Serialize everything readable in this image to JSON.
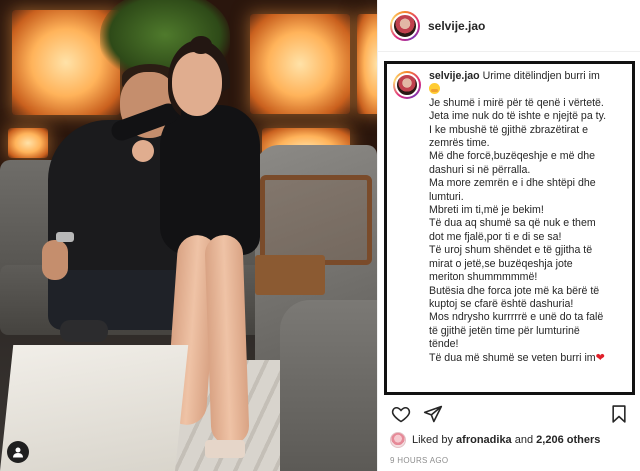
{
  "post": {
    "username": "selvije.jao",
    "caption_lines": [
      "Urime ditëlindjen burri im",
      "Je shumë i mirë për të qenë i vërtetë.",
      "Jeta ime nuk do të ishte e njejtë pa ty.",
      "I ke mbushë të gjithë zbrazëtirat e",
      "zemrës time.",
      "Më dhe forcë,buzëqeshje e më dhe",
      "dashuri si në përralla.",
      "Ma more zemrën e i dhe shtëpi dhe",
      "lumturi.",
      "Mbreti im ti,më je bekim!",
      "Të dua aq shumë sa që nuk e them",
      "dot me fjalë,por ti e di se sa!",
      "Të uroj shum shëndet e të gjitha të",
      "mirat o jetë,se buzëqeshja jote",
      "meriton shummmmmë!",
      "Butësia dhe forca jote më ka bërë të",
      "kuptoj se cfarë është dashuria!",
      "Mos ndrysho kurrrrrë e unë do ta falë",
      "të gjithë jetën time për lumturinë",
      "tënde!",
      "Të dua më shumë se veten burri im"
    ],
    "likes": {
      "prefix": "Liked by",
      "first_user": "afronadika",
      "conjunction": "and",
      "others": "2,206 others"
    },
    "timestamp": "9 HOURS AGO"
  },
  "icons": {
    "like": "heart-outline-icon",
    "share": "paper-plane-icon",
    "save": "bookmark-icon",
    "tag": "person-tag-icon"
  },
  "colors": {
    "heart_emoji": "#e0202a",
    "caption_border": "#111111",
    "timestamp": "#8e8e8e"
  }
}
